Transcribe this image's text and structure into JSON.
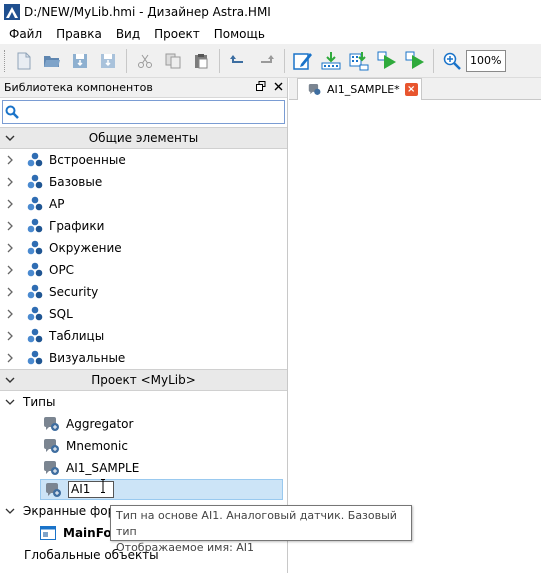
{
  "window": {
    "title": "D:/NEW/MyLib.hmi - Дизайнер Astra.HMI"
  },
  "menu": [
    "Файл",
    "Правка",
    "Вид",
    "Проект",
    "Помощь"
  ],
  "toolbar": {
    "buttons": [
      "new-icon",
      "open-icon",
      "save-icon",
      "save-all-icon",
      "cut-icon",
      "copy-icon",
      "paste-icon",
      "undo-icon",
      "redo-icon",
      "edit-icon",
      "build-icon",
      "deploy-icon",
      "run-icon",
      "run-alt-icon",
      "zoom-in-icon"
    ],
    "zoom": "100%"
  },
  "library": {
    "title": "Библиотека компонентов",
    "search_placeholder": "",
    "common_section": "Общие элементы",
    "common_items": [
      "Встроенные",
      "Базовые",
      "АР",
      "Графики",
      "Окружение",
      "OPC",
      "Security",
      "SQL",
      "Таблицы",
      "Визуальные"
    ],
    "project_section": "Проект <MyLib>",
    "types_label": "Типы",
    "types": [
      "Aggregator",
      "Mnemonic",
      "AI1_SAMPLE"
    ],
    "editing_value": "AI1",
    "screen_forms_label": "Экранные формы",
    "screen_form_item": "MainForm",
    "global_objects_label": "Глобальные объекты"
  },
  "document": {
    "tab_label": "AI1_SAMPLE*",
    "tab_close": "×"
  },
  "tooltip": {
    "line1": "Тип на основе AI1. Аналоговый датчик. Базовый тип",
    "line2": "Отображаемое имя: AI1"
  },
  "colors": {
    "accent": "#1a73c9",
    "selection": "#cce4f7",
    "close_tab": "#e8552e",
    "run_green": "#2faa3c"
  }
}
